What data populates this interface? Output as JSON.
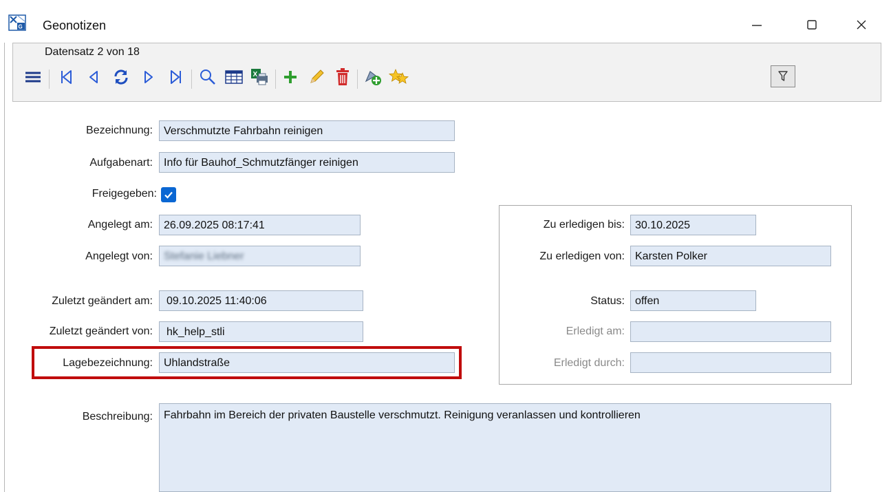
{
  "window": {
    "title": "Geonotizen",
    "icon": "geonotizen-app-icon"
  },
  "toolbar": {
    "record_info": "Datensatz 2 von 18",
    "tools": [
      {
        "name": "menu-icon"
      },
      {
        "name": "first-record-icon"
      },
      {
        "name": "previous-record-icon"
      },
      {
        "name": "refresh-icon"
      },
      {
        "name": "next-record-icon"
      },
      {
        "name": "last-record-icon"
      },
      {
        "name": "search-icon"
      },
      {
        "name": "table-icon"
      },
      {
        "name": "excel-export-icon"
      },
      {
        "name": "add-icon"
      },
      {
        "name": "edit-icon"
      },
      {
        "name": "delete-icon"
      },
      {
        "name": "add-geometry-icon"
      },
      {
        "name": "favorites-icon"
      }
    ],
    "filter_icon": "filter-icon"
  },
  "form": {
    "bezeichnung": {
      "label": "Bezeichnung:",
      "value": "Verschmutzte Fahrbahn reinigen"
    },
    "aufgabenart": {
      "label": "Aufgabenart:",
      "value": "Info für Bauhof_Schmutzfänger reinigen"
    },
    "freigegeben": {
      "label": "Freigegeben:",
      "checked": true
    },
    "angelegt_am": {
      "label": "Angelegt am:",
      "value": "26.09.2025 08:17:41"
    },
    "angelegt_von": {
      "label": "Angelegt von:",
      "value": "Stefanie Liebner",
      "blurred": true
    },
    "zuletzt_geaendert_am": {
      "label": "Zuletzt geändert am:",
      "value": "09.10.2025 11:40:06"
    },
    "zuletzt_geaendert_von": {
      "label": "Zuletzt geändert von:",
      "value": "hk_help_stli"
    },
    "lagebezeichnung": {
      "label": "Lagebezeichnung:",
      "value": "Uhlandstraße"
    },
    "beschreibung": {
      "label": "Beschreibung:",
      "value": "Fahrbahn im Bereich der privaten Baustelle verschmutzt. Reinigung veranlassen und kontrollieren"
    }
  },
  "task": {
    "zu_erledigen_bis": {
      "label": "Zu erledigen bis:",
      "value": "30.10.2025"
    },
    "zu_erledigen_von": {
      "label": "Zu erledigen von:",
      "value": "Karsten Polker"
    },
    "status": {
      "label": "Status:",
      "value": "offen"
    },
    "erledigt_am": {
      "label": "Erledigt am:",
      "value": ""
    },
    "erledigt_durch": {
      "label": "Erledigt durch:",
      "value": ""
    }
  },
  "colors": {
    "field_bg": "#e1eaf6",
    "field_border": "#a6b3c3",
    "highlight": "#c00c0c",
    "checkbox": "#0a67d3"
  }
}
